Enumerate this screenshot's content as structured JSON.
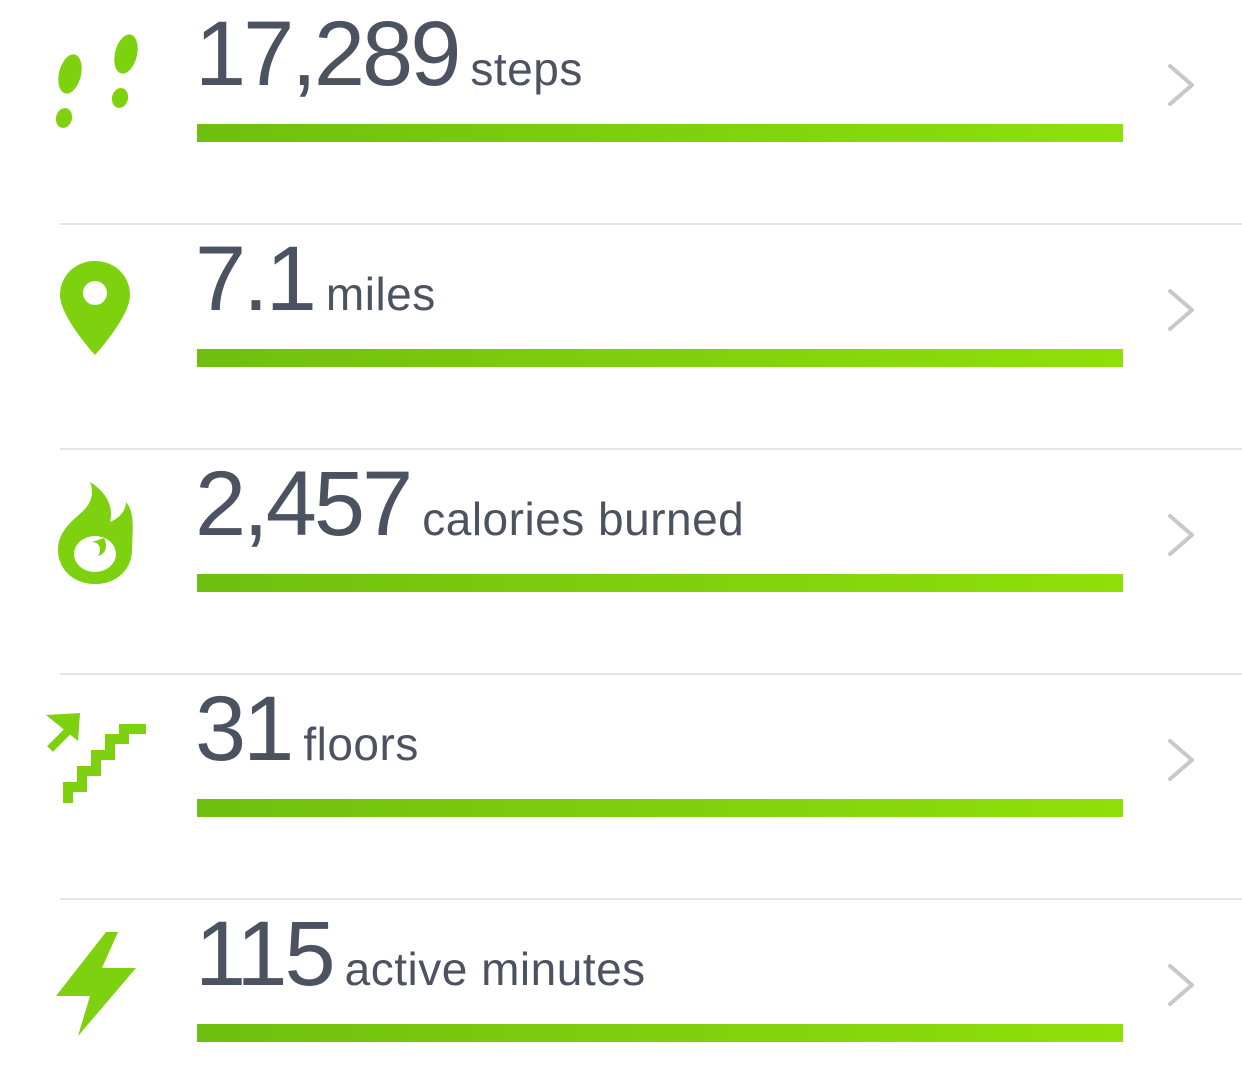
{
  "accent_color": "#7ed10e",
  "text_color": "#4b5260",
  "metrics": [
    {
      "value": "17,289",
      "unit": "steps",
      "icon": "footprints-icon",
      "progress": 1.0
    },
    {
      "value": "7.1",
      "unit": "miles",
      "icon": "location-pin-icon",
      "progress": 1.0
    },
    {
      "value": "2,457",
      "unit": "calories burned",
      "icon": "flame-icon",
      "progress": 1.0
    },
    {
      "value": "31",
      "unit": "floors",
      "icon": "stairs-icon",
      "progress": 1.0
    },
    {
      "value": "115",
      "unit": "active minutes",
      "icon": "lightning-bolt-icon",
      "progress": 1.0
    }
  ]
}
